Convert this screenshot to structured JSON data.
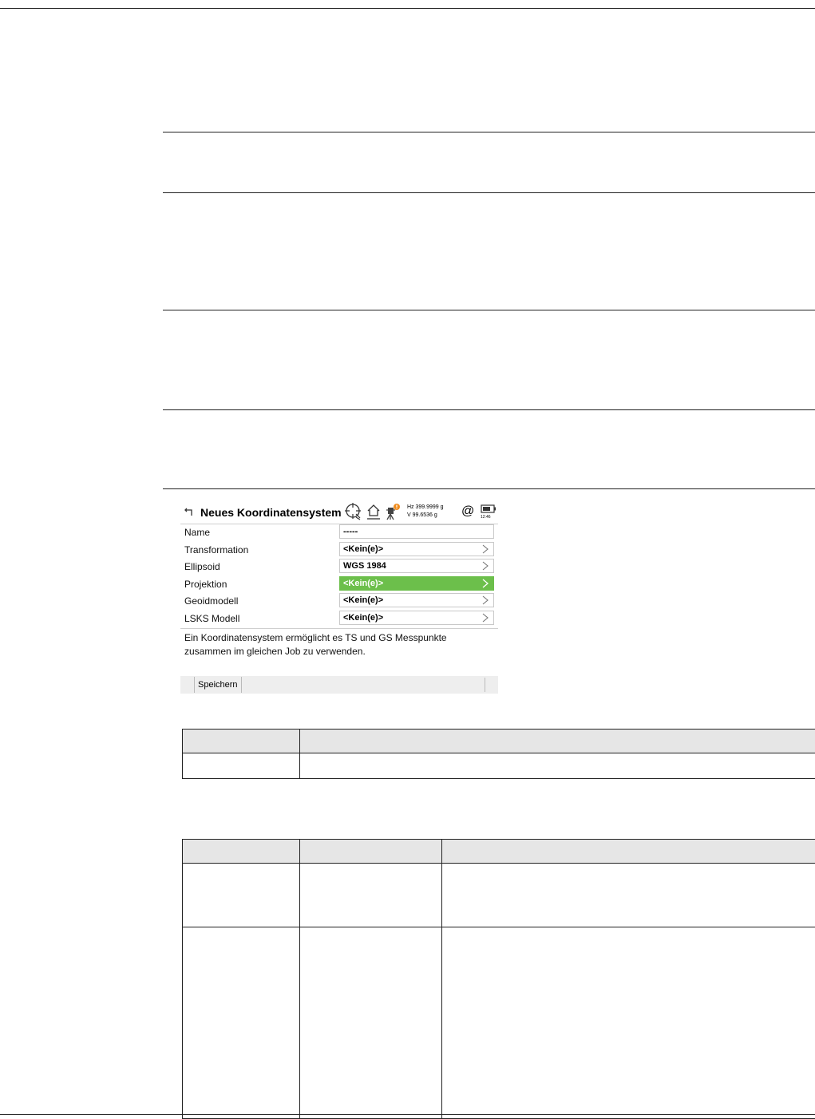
{
  "screen": {
    "title": "Neues Koordinatensystem",
    "hz_readout": "Hz 399.9999 g",
    "v_readout": "V   99.6536 g",
    "at_symbol": "@",
    "time": "12:46",
    "fields": [
      {
        "label": "Name",
        "value": "-----"
      },
      {
        "label": "Transformation",
        "value": "<Kein(e)>"
      },
      {
        "label": "Ellipsoid",
        "value": "WGS 1984"
      },
      {
        "label": "Projektion",
        "value": "<Kein(e)>"
      },
      {
        "label": "Geoidmodell",
        "value": "<Kein(e)>"
      },
      {
        "label": "LSKS Modell",
        "value": "<Kein(e)>"
      }
    ],
    "description": "Ein Koordinatensystem ermöglicht es TS und GS Messpunkte zusammen im gleichen Job zu verwenden.",
    "softkey_save": "Speichern",
    "colors": {
      "highlight": "#6cbf4b"
    }
  }
}
